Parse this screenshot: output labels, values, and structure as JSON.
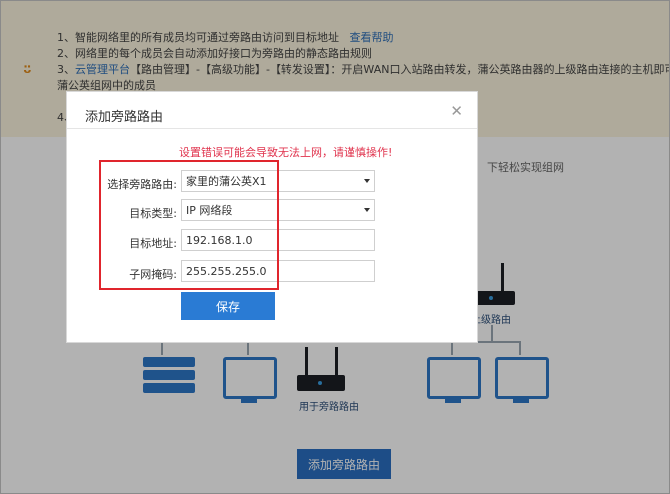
{
  "tips": {
    "line1": "1、智能网络里的所有成员均可通过旁路由访问到目标地址",
    "line1_link": "查看帮助",
    "line2": "2、网络里的每个成员会自动添加好接口为旁路由的静态路由规则",
    "line3_prefix": "3、",
    "line3_link": "云管理平台",
    "line3_rest": "【路由管理】-【高级功能】-【转发设置】：开启WAN口入站路由转发，蒲公英路由器的上级路由连接的主机即可访问",
    "line3_cont": "蒲公英组网中的成员",
    "line4": "4、"
  },
  "diagram": {
    "caption_right": "下轻松实现组网",
    "upper_router_label": "上级路由",
    "bypass_router_label": "用于旁路路由"
  },
  "bottom_button": "添加旁路路由",
  "dialog": {
    "title": "添加旁路路由",
    "warning": "设置错误可能会导致无法上网，请谨慎操作!",
    "fields": [
      {
        "label": "选择旁路路由:",
        "value": "家里的蒲公英X1",
        "type": "select"
      },
      {
        "label": "目标类型:",
        "value": "IP 网络段",
        "type": "select"
      },
      {
        "label": "目标地址:",
        "value": "192.168.1.0",
        "type": "input"
      },
      {
        "label": "子网掩码:",
        "value": "255.255.255.0",
        "type": "input"
      }
    ],
    "save_label": "保存"
  },
  "colors": {
    "accent": "#2a7bd4",
    "warning": "#e0334d",
    "highlight_box": "#e0252d",
    "tips_bg": "#fbf4de"
  },
  "icons": {
    "smile": "smile-icon",
    "close": "close-icon",
    "dropdown": "chevron-down-icon"
  }
}
